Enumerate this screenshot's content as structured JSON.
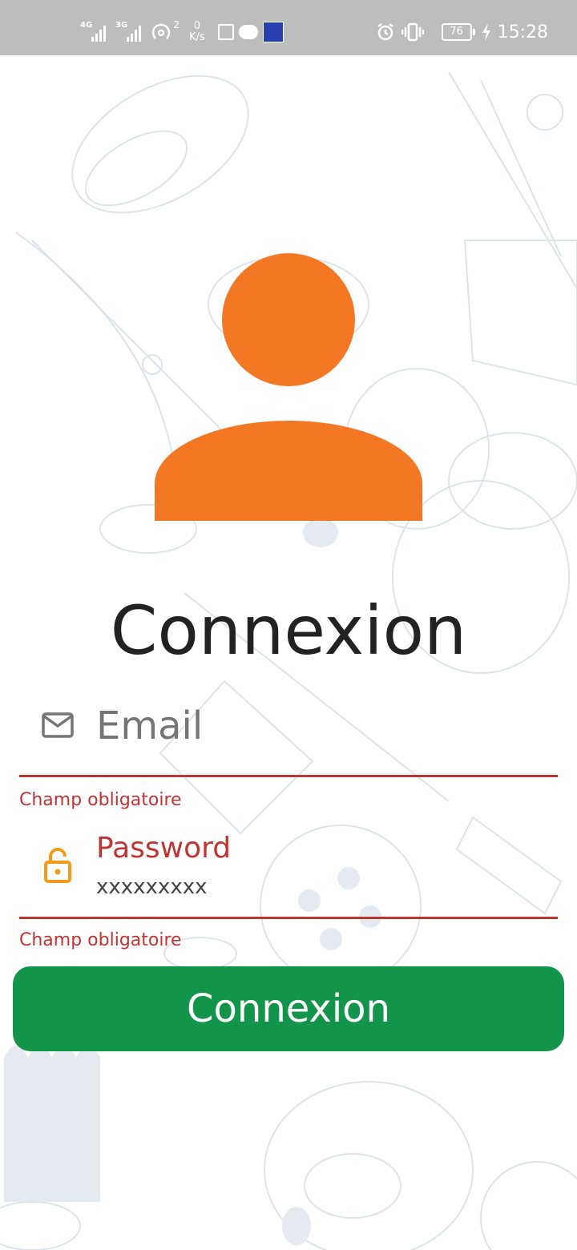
{
  "status_bar": {
    "network_1": "4G",
    "network_2": "3G",
    "hotspot_count": "2",
    "speed_value": "0",
    "speed_unit": "K/s",
    "battery": "76",
    "time": "15:28"
  },
  "login": {
    "title": "Connexion",
    "email": {
      "placeholder": "Email",
      "error": "Champ obligatoire"
    },
    "password": {
      "label": "Password",
      "value": "xxxxxxxxx",
      "error": "Champ obligatoire"
    },
    "submit_label": "Connexion"
  },
  "colors": {
    "accent": "#f47824",
    "error": "#c23432",
    "button": "#12944a",
    "lock_icon": "#f39b16"
  },
  "icons": [
    "mail-icon",
    "lock-icon",
    "alarm-icon",
    "vibrate-icon",
    "battery-icon",
    "message-icon",
    "hotspot-icon"
  ]
}
